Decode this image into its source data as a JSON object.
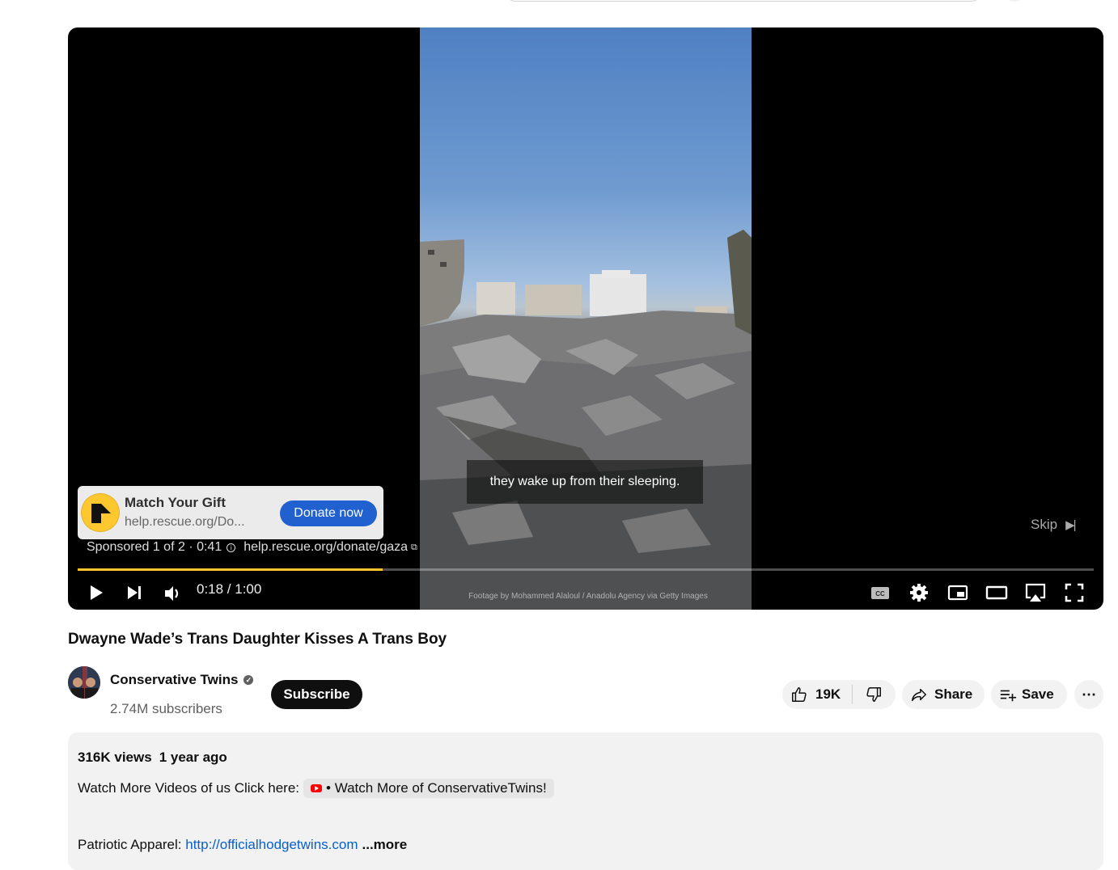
{
  "player": {
    "subtitle": "they wake up from their sleeping.",
    "footage_credit": "Footage by Mohammed Alaloul / Anadolu Agency via Getty Images",
    "ad": {
      "title": "Match Your Gift",
      "url": "help.rescue.org/Do...",
      "cta": "Donate now",
      "sponsored": "Sponsored 1 of 2 · 0:41",
      "link": "help.rescue.org/donate/gaza"
    },
    "skip_label": "Skip",
    "progress": 0.3,
    "time": "0:18 / 1:00",
    "accent_color": "#fcc52f",
    "controls": [
      "play-icon",
      "next-icon",
      "volume-icon",
      "captions-icon",
      "settings-icon",
      "miniplayer-icon",
      "theater-icon",
      "airplay-icon",
      "fullscreen-icon"
    ]
  },
  "video": {
    "title": "Dwayne Wade’s Trans Daughter Kisses A Trans Boy"
  },
  "channel": {
    "name": "Conservative Twins",
    "subscribers": "2.74M subscribers",
    "subscribe_label": "Subscribe"
  },
  "actions": {
    "likes": "19K",
    "share_label": "Share",
    "save_label": "Save",
    "more_label": "⋯"
  },
  "description": {
    "views": "316K views",
    "age": "1 year ago",
    "line1_prefix": "Watch More Videos of us Click here:",
    "line1_chip": "• Watch More of ConservativeTwins!",
    "line2_prefix": "Patriotic Apparel:",
    "line2_link": "http://officialhodgetwins.com",
    "more_label": "...more"
  }
}
